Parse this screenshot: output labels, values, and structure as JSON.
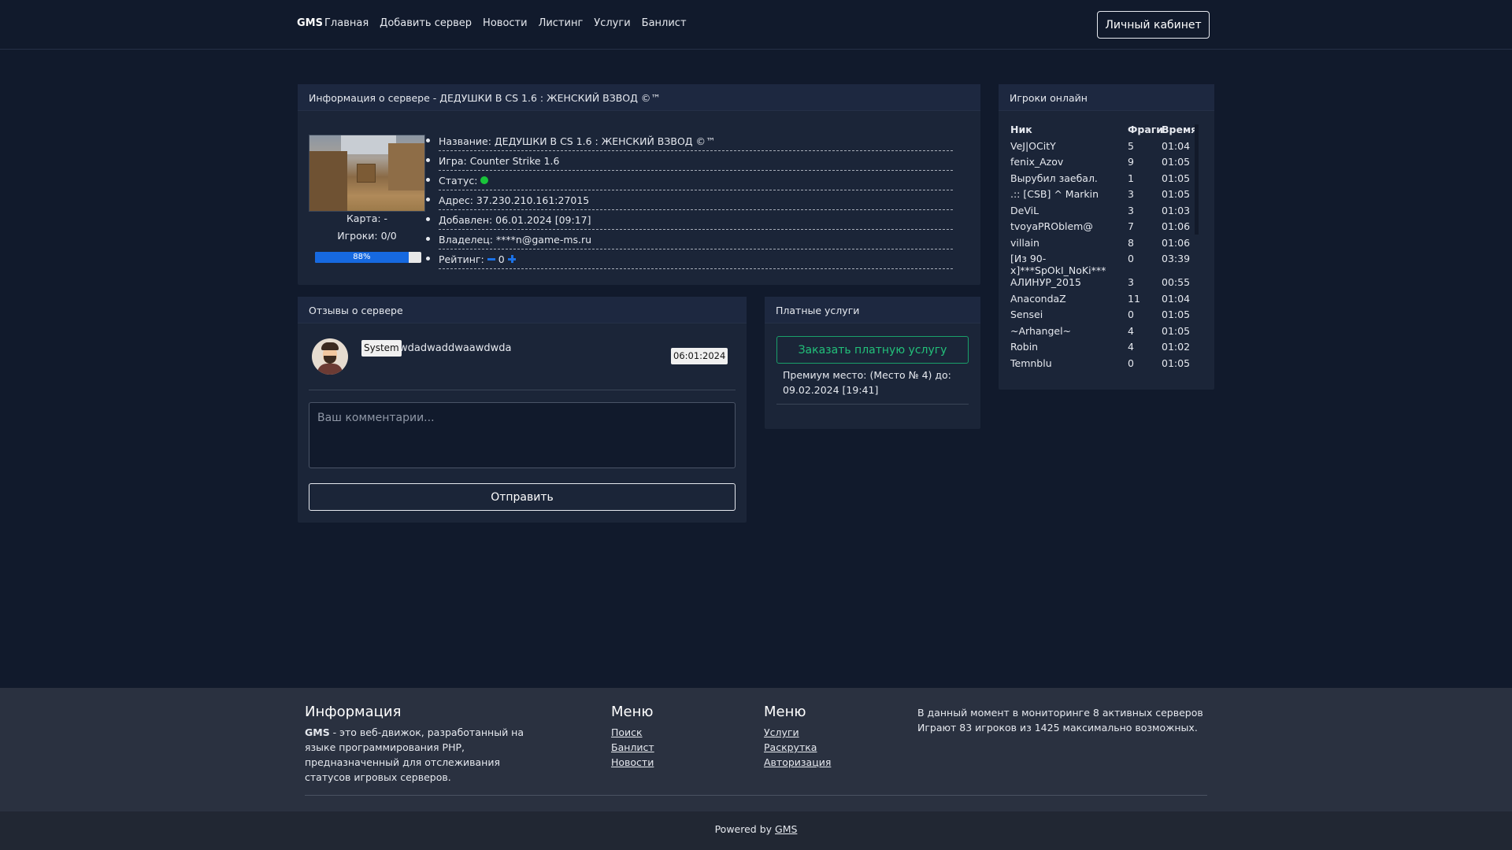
{
  "nav": {
    "brand": "GMS",
    "links": [
      "Главная",
      "Добавить сервер",
      "Новости",
      "Листинг",
      "Услуги",
      "Банлист"
    ],
    "cabinet_button": "Личный кабинет"
  },
  "server": {
    "header": "Информация о сервере - ДЕДУШКИ В CS 1.6 : ЖЕНСКИЙ ВЗВОД ©™",
    "map_label": "Карта: -",
    "players_label": "Игроки: 0/0",
    "progress_percent": 88,
    "progress_label": "88%",
    "info": {
      "name": "Название: ДЕДУШКИ В CS 1.6 : ЖЕНСКИЙ ВЗВОД ©™",
      "game": "Игра: Counter Strike 1.6",
      "status": "Статус:",
      "status_color": "#19c43a",
      "address": "Адрес: 37.230.210.161:27015",
      "added": "Добавлен: 06.01.2024 [09:17]",
      "owner": "Владелец: ****n@game-ms.ru",
      "rating_label": "Рейтинг:",
      "rating_value": "0"
    }
  },
  "players": {
    "header": "Игроки онлайн",
    "columns": [
      "Ник",
      "Фраги",
      "Время"
    ],
    "rows": [
      {
        "nick": "VeJ|OCitY",
        "frags": "5",
        "time": "01:04"
      },
      {
        "nick": "fenix_Azov",
        "frags": "9",
        "time": "01:05"
      },
      {
        "nick": "Вырубил заебал.",
        "frags": "1",
        "time": "01:05"
      },
      {
        "nick": ".:: [CSB] ^ Markin",
        "frags": "3",
        "time": "01:05"
      },
      {
        "nick": "DeViL",
        "frags": "3",
        "time": "01:03"
      },
      {
        "nick": "tvoyaPROblem@",
        "frags": "7",
        "time": "01:06"
      },
      {
        "nick": "villain",
        "frags": "8",
        "time": "01:06"
      },
      {
        "nick": "[Из 90-х]***SpOkI_NoKi***",
        "frags": "0",
        "time": "03:39"
      },
      {
        "nick": "АЛИНУР_2015",
        "frags": "3",
        "time": "00:55"
      },
      {
        "nick": "AnacondaZ",
        "frags": "11",
        "time": "01:04"
      },
      {
        "nick": "Sensei",
        "frags": "0",
        "time": "01:05"
      },
      {
        "nick": "~Arhangel~",
        "frags": "4",
        "time": "01:05"
      },
      {
        "nick": "Robin",
        "frags": "4",
        "time": "01:02"
      },
      {
        "nick": "Temnblu",
        "frags": "0",
        "time": "01:05"
      }
    ]
  },
  "reviews": {
    "header": "Отзывы о сервере",
    "author_badge": "System",
    "text": "wdadwaddwaawdwda",
    "date": "06:01:2024",
    "comment_placeholder": "Ваш комментарии...",
    "send_button": "Отправить"
  },
  "paid": {
    "header": "Платные услуги",
    "order_button": "Заказать платную услугу",
    "premium_line1": "Премиум место: (Место № 4) до:",
    "premium_line2": "09.02.2024 [19:41]"
  },
  "footer": {
    "info_title": "Информация",
    "info_brand": "GMS",
    "info_text": " - это веб-движок, разработанный на языке программирования PHP, предназначенный для отслеживания статусов игровых серверов.",
    "menu1_title": "Меню",
    "menu1_links": [
      "Поиск",
      "Банлист",
      "Новости"
    ],
    "menu2_title": "Меню",
    "menu2_links": [
      "Услуги",
      "Раскрутка",
      "Авторизация"
    ],
    "stats_line1": "В данный момент в мониторинге 8 активных серверов",
    "stats_line2": "Играют 83 игроков из 1425 максимально возможных.",
    "powered_prefix": "Powered by ",
    "powered_link": "GMS"
  }
}
